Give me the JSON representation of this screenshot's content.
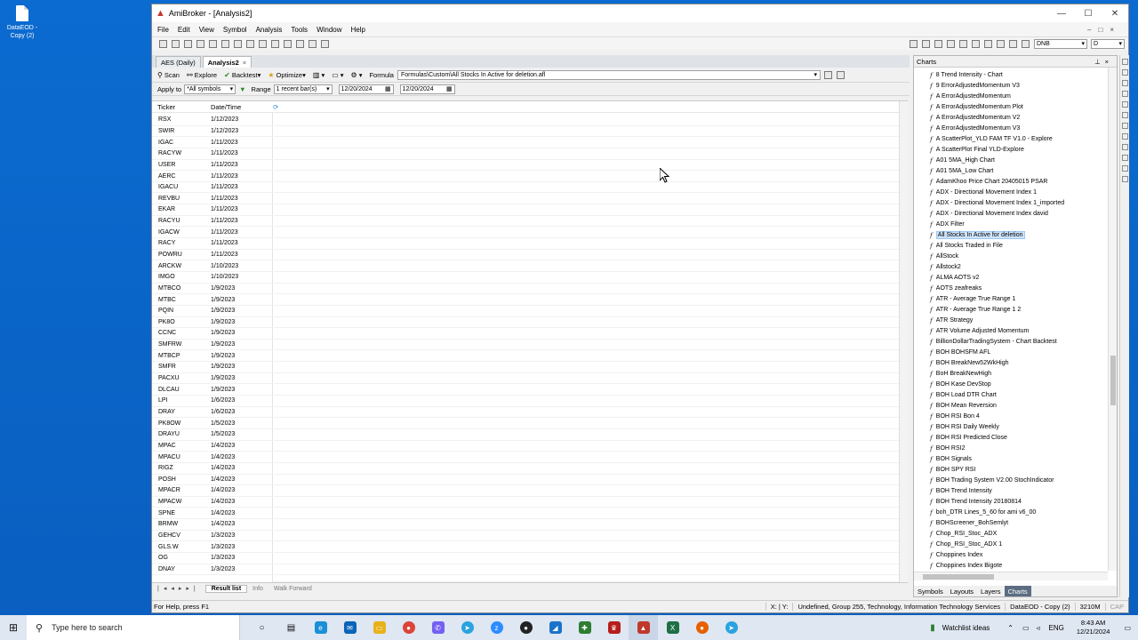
{
  "desktop": {
    "icon_label": "DataEOD -\nCopy (2)"
  },
  "window": {
    "app_title": "AmiBroker - [Analysis2]",
    "controls": [
      "—",
      "☐",
      "✕"
    ]
  },
  "menu": [
    "File",
    "Edit",
    "View",
    "Symbol",
    "Analysis",
    "Tools",
    "Window",
    "Help"
  ],
  "toolbar": {
    "symbol_value": "DNB",
    "interval_value": "D"
  },
  "doc_tabs": [
    {
      "label": "AES (Daily)"
    },
    {
      "label": "Analysis2",
      "close": "×"
    }
  ],
  "analysis_bar": {
    "scan": "Scan",
    "explore": "Explore",
    "backtest": "Backtest",
    "optimize": "Optimize",
    "formula_label": "Formula",
    "formula_path": "Formulas\\Custom\\All Stocks In Active for deletion.afl",
    "apply_to_label": "Apply to",
    "apply_to_value": "*All symbols",
    "range_label": "Range",
    "range_value": "1 recent bar(s)",
    "from_date": "12/20/2024",
    "to_date": "12/20/2024"
  },
  "results": {
    "headers": {
      "ticker": "Ticker",
      "date": "Date/Time"
    },
    "rows": [
      [
        "RSX",
        "1/12/2023"
      ],
      [
        "SWIR",
        "1/12/2023"
      ],
      [
        "IGAC",
        "1/11/2023"
      ],
      [
        "RACYW",
        "1/11/2023"
      ],
      [
        "USER",
        "1/11/2023"
      ],
      [
        "AERC",
        "1/11/2023"
      ],
      [
        "IGACU",
        "1/11/2023"
      ],
      [
        "REVBU",
        "1/11/2023"
      ],
      [
        "EKAR",
        "1/11/2023"
      ],
      [
        "RACYU",
        "1/11/2023"
      ],
      [
        "IGACW",
        "1/11/2023"
      ],
      [
        "RACY",
        "1/11/2023"
      ],
      [
        "POWRU",
        "1/11/2023"
      ],
      [
        "ARCKW",
        "1/10/2023"
      ],
      [
        "IMGO",
        "1/10/2023"
      ],
      [
        "MTBCO",
        "1/9/2023"
      ],
      [
        "MTBC",
        "1/9/2023"
      ],
      [
        "PQIN",
        "1/9/2023"
      ],
      [
        "PK8O",
        "1/9/2023"
      ],
      [
        "CCNC",
        "1/9/2023"
      ],
      [
        "SMFRW",
        "1/9/2023"
      ],
      [
        "MTBCP",
        "1/9/2023"
      ],
      [
        "SMFR",
        "1/9/2023"
      ],
      [
        "PACXU",
        "1/9/2023"
      ],
      [
        "DLCAU",
        "1/9/2023"
      ],
      [
        "LPI",
        "1/6/2023"
      ],
      [
        "DRAY",
        "1/6/2023"
      ],
      [
        "PK8OW",
        "1/5/2023"
      ],
      [
        "DRAYU",
        "1/5/2023"
      ],
      [
        "MPAC",
        "1/4/2023"
      ],
      [
        "MPACU",
        "1/4/2023"
      ],
      [
        "RIGZ",
        "1/4/2023"
      ],
      [
        "POSH",
        "1/4/2023"
      ],
      [
        "MPACR",
        "1/4/2023"
      ],
      [
        "MPACW",
        "1/4/2023"
      ],
      [
        "SPNE",
        "1/4/2023"
      ],
      [
        "BRMW",
        "1/4/2023"
      ],
      [
        "GEHCV",
        "1/3/2023"
      ],
      [
        "GLS.W",
        "1/3/2023"
      ],
      [
        "OG",
        "1/3/2023"
      ],
      [
        "DNAY",
        "1/3/2023"
      ]
    ]
  },
  "bottom_tabs": [
    "Result list",
    "Info",
    "Walk Forward"
  ],
  "charts_panel": {
    "title": "Charts",
    "items": [
      "8 Trend Intensity - Chart",
      "9 ErrorAdjustedMomentum V3",
      "A ErrorAdjustedMomentum",
      "A ErrorAdjustedMomentum Plot",
      "A ErrorAdjustedMomentum V2",
      "A ErrorAdjustedMomentum V3",
      "A ScatterPlot_YLD FAM TF V1.0 - Explore",
      "A ScatterPlot Final YLD-Explore",
      "A01 5MA_High Chart",
      "A01 5MA_Low Chart",
      "AdamKhoo Price Chart 20405015 PSAR",
      "ADX - Directional Movement Index 1",
      "ADX - Directional Movement Index 1_imported",
      "ADX - Directional Movement Index david",
      "ADX Filter",
      "All Stocks In Active for deletion",
      "All Stocks Traded in File",
      "AllStock",
      "Allstock2",
      "ALMA AOTS v2",
      "AOTS zeafreaks",
      "ATR - Average True Range 1",
      "ATR - Average True Range 1 2",
      "ATR Strategy",
      "ATR Volume Adjusted Momentum",
      "BillionDollarTradingSystem - Chart Backtest",
      "BOH BOHSFM AFL",
      "BOH BreakNew52WkHigh",
      "BoH BreakNewHigh",
      "BOH Kase DevStop",
      "BOH Load DTR Chart",
      "BOH Mean Reversion",
      "BOH RSI Bon 4",
      "BOH RSI Daily Weekly",
      "BOH RSI Predicted Close",
      "BOH RSI2",
      "BOH Signals",
      "BOH SPY RSI",
      "BOH Trading System V2.00 StochIndicator",
      "BOH Trend Intensity",
      "BOH Trend Intensity 20180814",
      "boh_DTR Lines_5_60 for ami v6_00",
      "BOHScreener_BohSemlyt",
      "Chop_RSI_Stoc_ADX",
      "Chop_RSI_Stoc_ADX 1",
      "Choppines Index",
      "Choppines Index Bigote"
    ],
    "selected_index": 15,
    "tabs": [
      "Symbols",
      "Layouts",
      "Layers",
      "Charts"
    ]
  },
  "status": {
    "help": "For Help, press F1",
    "coords": "X: | Y:",
    "sector": "Undefined, Group 255, Technology, Information Technology Services",
    "database": "DataEOD - Copy (2)",
    "memory": "3210M",
    "cap": "CAP"
  },
  "taskbar": {
    "search_placeholder": "Type here to search",
    "watchlist": "Watchlist ideas",
    "lang": "ENG",
    "time": "8:43 AM",
    "date": "12/21/2024"
  }
}
